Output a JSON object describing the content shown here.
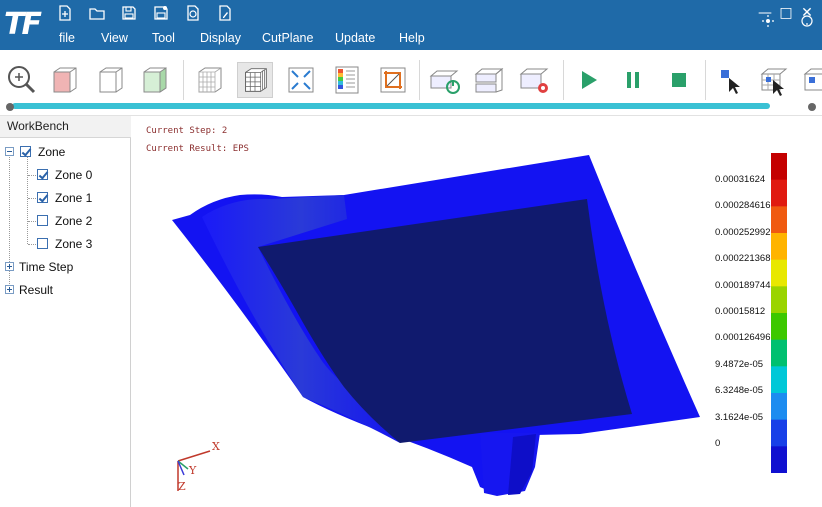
{
  "app": {
    "logo": "TF"
  },
  "menu": {
    "items": [
      "file",
      "View",
      "Tool",
      "Display",
      "CutPlane",
      "Update",
      "Help"
    ]
  },
  "window_controls": {
    "minimize": "—",
    "maximize": "□",
    "close": "✕"
  },
  "quick_access": [
    "new-file-icon",
    "open-folder-icon",
    "save-icon",
    "save-as-icon",
    "export-icon",
    "edit-file-icon"
  ],
  "toolbar": {
    "buttons": [
      "zoom-fit-icon",
      "view-left-cube-icon",
      "view-iso-cube-icon",
      "view-right-cube-icon",
      "wireframe-cube-icon",
      "mesh-cube-icon",
      "shrink-icon",
      "contour-icon",
      "crop-icon",
      "power-cube-icon",
      "split-cube-icon",
      "settings-cube-icon",
      "play-icon",
      "pause-icon",
      "stop-icon",
      "pick-point-icon",
      "pick-mesh-icon",
      "pick-cell-icon"
    ],
    "accent_play": "#2aa06a"
  },
  "workbench": {
    "title": "WorkBench",
    "tree": {
      "zone": {
        "label": "Zone",
        "checked": true
      },
      "zones": [
        {
          "label": "Zone 0",
          "checked": true
        },
        {
          "label": "Zone 1",
          "checked": true
        },
        {
          "label": "Zone 2",
          "checked": false
        },
        {
          "label": "Zone 3",
          "checked": false
        }
      ],
      "time_step": {
        "label": "Time Step"
      },
      "result": {
        "label": "Result"
      }
    }
  },
  "viewport": {
    "current_step": "Current Step: 2",
    "current_result": "Current Result: EPS",
    "legend": {
      "labels": [
        "0.00031624",
        "0.000284616",
        "0.000252992",
        "0.000221368",
        "0.000189744",
        "0.00015812",
        "0.000126496",
        "9.4872e-05",
        "6.3248e-05",
        "3.1624e-05",
        "0"
      ],
      "colors": [
        "#c40000",
        "#e01a10",
        "#f05a10",
        "#ffb400",
        "#e8e800",
        "#9ad400",
        "#3cc800",
        "#00c070",
        "#00c8d8",
        "#1c8cf0",
        "#1840e8",
        "#1010d0"
      ]
    },
    "axes": {
      "x": "X",
      "y": "Y",
      "z": "Z"
    },
    "colors": {
      "surface": "#1212f0",
      "top_face": "#101a6e"
    }
  }
}
